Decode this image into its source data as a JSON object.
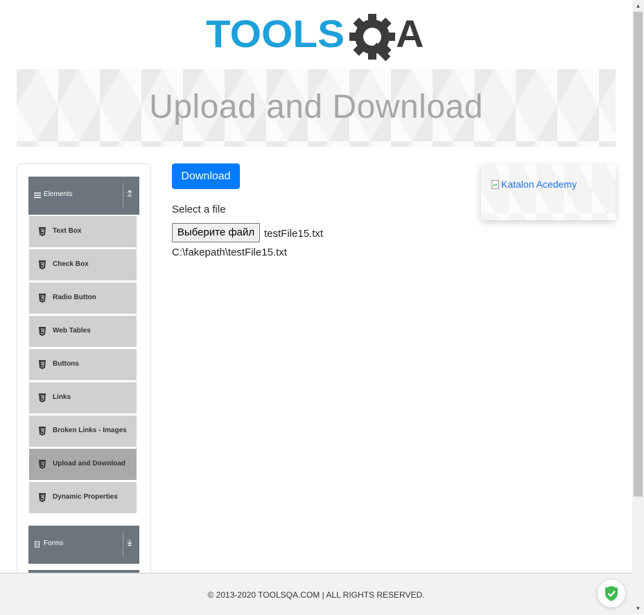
{
  "logo": {
    "text_left": "TOOLS",
    "text_right": "A"
  },
  "banner": {
    "title": "Upload and Download"
  },
  "sidebar": {
    "groups": [
      {
        "label": "Elements",
        "icon": "hamburger-icon",
        "arrow": "arrow-up-icon"
      },
      {
        "label": "Forms",
        "icon": "document-icon",
        "arrow": "arrow-down-icon"
      }
    ],
    "items": [
      {
        "label": "Text Box"
      },
      {
        "label": "Check Box"
      },
      {
        "label": "Radio Button"
      },
      {
        "label": "Web Tables"
      },
      {
        "label": "Buttons"
      },
      {
        "label": "Links"
      },
      {
        "label": "Broken Links - Images"
      },
      {
        "label": "Upload and Download",
        "active": true
      },
      {
        "label": "Dynamic Properties"
      }
    ]
  },
  "main": {
    "download_label": "Download",
    "select_label": "Select a file",
    "file_button_label": "Выберите файл",
    "file_name": "testFile15.txt",
    "file_path": "C:\\fakepath\\testFile15.txt"
  },
  "ad": {
    "alt_text": "Katalon Acedemy"
  },
  "footer": {
    "text": "© 2013-2020 TOOLSQA.COM | ALL RIGHTS RESERVED."
  },
  "colors": {
    "primary": "#007bff",
    "sidebar_header": "#6c757d",
    "menu_item": "#d0d0d0",
    "menu_active": "#a9a9a9",
    "logo_blue": "#1ea0db",
    "logo_dark": "#3b3b3b",
    "shield_green": "#3fb950"
  }
}
